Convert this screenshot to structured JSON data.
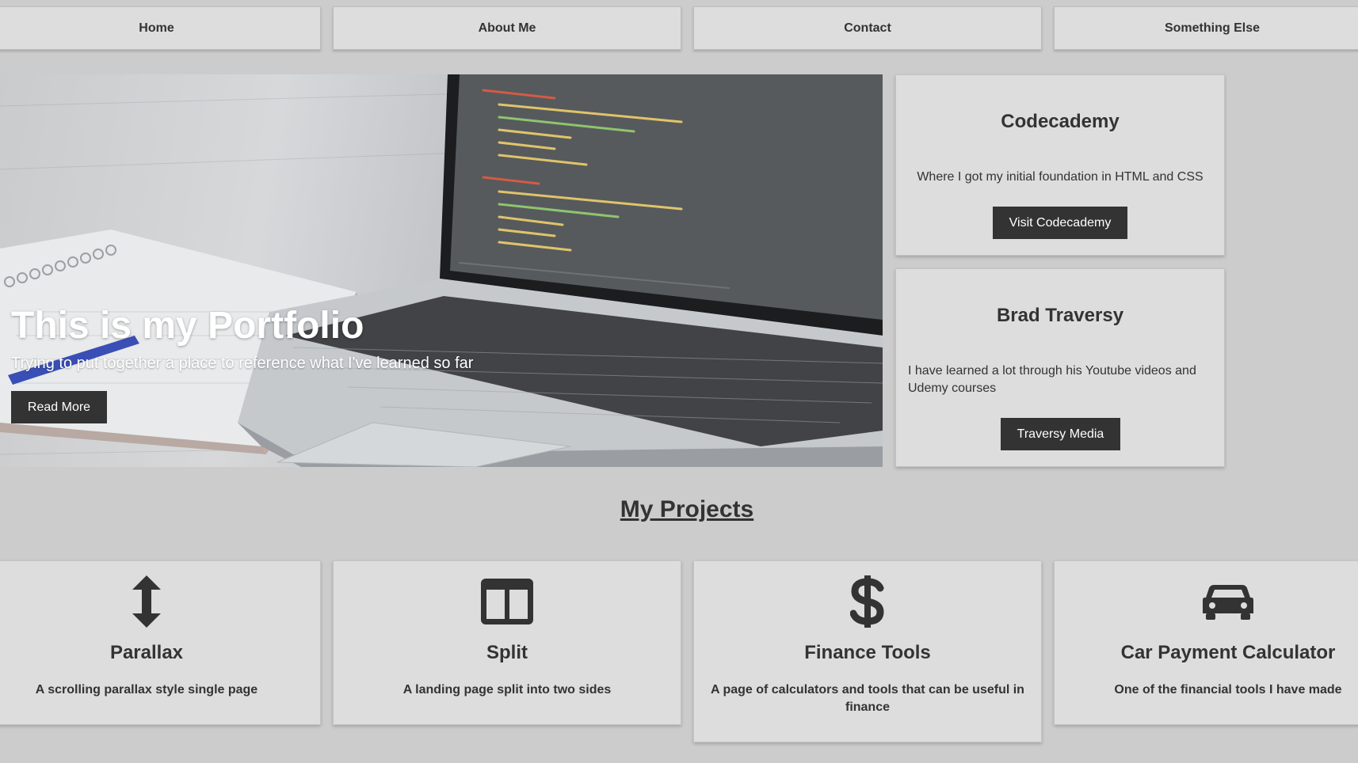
{
  "nav": {
    "items": [
      {
        "label": "Home"
      },
      {
        "label": "About Me"
      },
      {
        "label": "Contact"
      },
      {
        "label": "Something Else"
      }
    ]
  },
  "hero": {
    "title": "This is my Portfolio",
    "subtitle": "Trying to put together a place to reference what I've learned so far",
    "button_label": "Read More"
  },
  "sidebar": {
    "cards": [
      {
        "title": "Codecademy",
        "text": "Where I got my initial foundation in HTML and CSS",
        "button_label": "Visit Codecademy"
      },
      {
        "title": "Brad Traversy",
        "text": "I have learned a lot through his Youtube videos and Udemy courses",
        "button_label": "Traversy Media"
      }
    ]
  },
  "projects": {
    "heading": "My Projects",
    "items": [
      {
        "icon": "arrows-vertical-icon",
        "title": "Parallax",
        "text": "A scrolling parallax style single page"
      },
      {
        "icon": "columns-icon",
        "title": "Split",
        "text": "A landing page split into two sides"
      },
      {
        "icon": "dollar-icon",
        "title": "Finance Tools",
        "text": "A page of calculators and tools that can be useful in finance"
      },
      {
        "icon": "car-icon",
        "title": "Car Payment Calculator",
        "text": "One of the financial tools I have made"
      }
    ]
  },
  "colors": {
    "background": "#cccccc",
    "card": "#dddddd",
    "text": "#333333",
    "button": "#333333",
    "button_text": "#ffffff"
  }
}
